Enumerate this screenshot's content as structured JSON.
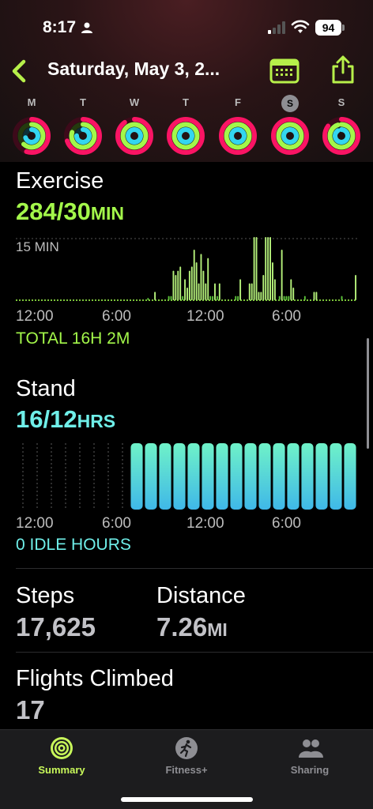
{
  "status_bar": {
    "time": "8:17",
    "battery": "94"
  },
  "nav": {
    "title": "Saturday, May 3, 2..."
  },
  "week": {
    "days": [
      {
        "label": "M",
        "selected": false,
        "move": 0.55,
        "exercise": 0.62,
        "stand": 0.7
      },
      {
        "label": "T",
        "selected": false,
        "move": 0.7,
        "exercise": 0.8,
        "stand": 0.75
      },
      {
        "label": "W",
        "selected": false,
        "move": 0.9,
        "exercise": 1.0,
        "stand": 1.0
      },
      {
        "label": "T",
        "selected": false,
        "move": 1.0,
        "exercise": 1.0,
        "stand": 1.0
      },
      {
        "label": "F",
        "selected": false,
        "move": 1.0,
        "exercise": 1.0,
        "stand": 1.0
      },
      {
        "label": "S",
        "selected": true,
        "move": 1.0,
        "exercise": 1.0,
        "stand": 1.0
      },
      {
        "label": "S",
        "selected": false,
        "move": 0.85,
        "exercise": 0.95,
        "stand": 0.9
      }
    ]
  },
  "exercise": {
    "title": "Exercise",
    "value": "284/30",
    "unit": "MIN",
    "scale_label": "15 MIN",
    "axis": [
      "12:00",
      "6:00",
      "12:00",
      "6:00"
    ],
    "total": "TOTAL 16H 2M",
    "color": "#a3f74a"
  },
  "stand": {
    "title": "Stand",
    "value": "16/12",
    "unit": "HRS",
    "axis": [
      "12:00",
      "6:00",
      "12:00",
      "6:00"
    ],
    "idle": "0 IDLE HOURS",
    "color": "#5fe0e0"
  },
  "steps": {
    "label": "Steps",
    "value": "17,625"
  },
  "distance": {
    "label": "Distance",
    "value": "7.26",
    "unit": "MI"
  },
  "flights": {
    "label": "Flights Climbed",
    "value": "17"
  },
  "tabs": [
    {
      "label": "Summary",
      "icon": "activity-rings-icon",
      "active": true
    },
    {
      "label": "Fitness+",
      "icon": "running-figure-icon",
      "active": false
    },
    {
      "label": "Sharing",
      "icon": "people-icon",
      "active": false
    }
  ],
  "chart_data": [
    {
      "type": "bar",
      "title": "Exercise",
      "ylabel": "MIN",
      "ylim": [
        0,
        15
      ],
      "x_ticks": [
        "12:00",
        "6:00",
        "12:00",
        "6:00"
      ],
      "values": [
        0,
        0,
        0,
        0,
        0,
        0,
        0,
        0,
        0,
        0,
        0,
        0,
        0,
        0,
        0,
        0,
        0,
        0,
        0,
        0,
        0,
        0,
        0,
        0,
        0,
        0,
        0,
        0,
        0,
        0,
        0,
        0,
        0,
        0,
        0,
        0,
        0,
        0,
        0,
        0,
        0,
        0,
        0,
        0,
        0,
        0,
        0,
        0,
        0,
        0,
        0,
        0,
        0,
        0,
        0,
        0,
        0,
        0.5,
        0,
        0,
        2,
        0,
        0,
        0,
        0,
        0,
        1,
        1,
        7,
        6,
        7,
        8,
        1,
        5,
        3,
        7,
        8,
        12,
        9,
        4,
        11,
        7,
        4,
        10,
        1,
        1,
        4,
        1,
        4,
        0,
        0,
        0,
        0,
        0,
        0,
        1,
        1,
        5,
        0,
        0,
        0,
        4,
        4,
        15,
        15,
        2,
        2,
        6,
        15,
        15,
        15,
        9,
        5,
        0,
        1,
        12,
        1,
        1,
        1,
        5,
        3,
        0,
        0,
        0,
        0,
        1,
        0,
        0,
        0,
        2,
        2,
        0,
        0,
        0,
        0,
        0,
        0,
        0,
        0,
        0,
        0,
        1,
        0,
        0,
        0,
        0,
        0,
        6
      ]
    },
    {
      "type": "bar",
      "title": "Stand",
      "ylabel": "HRS",
      "x_ticks": [
        "12:00",
        "6:00",
        "12:00",
        "6:00"
      ],
      "values": [
        0,
        0,
        0,
        0,
        0,
        0,
        0,
        0,
        1,
        1,
        1,
        1,
        1,
        1,
        1,
        1,
        1,
        1,
        1,
        1,
        1,
        1,
        1,
        1
      ]
    }
  ]
}
